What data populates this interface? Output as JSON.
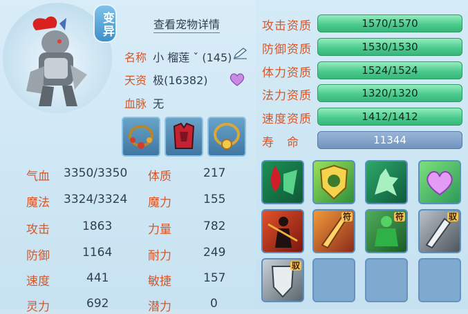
{
  "pet": {
    "mutation_badge": "变异",
    "view_details": "查看宠物详情",
    "name_label": "名称",
    "name_value": "小 榴莲 ˇ (145)",
    "talent_label": "天资",
    "talent_value": "极(16382)",
    "bloodline_label": "血脉",
    "bloodline_value": "无"
  },
  "equipment": [
    {
      "icon": "necklace-red-icon"
    },
    {
      "icon": "armor-red-icon"
    },
    {
      "icon": "necklace-gold-icon"
    }
  ],
  "stats": {
    "left": [
      {
        "label": "气血",
        "value": "3350/3350"
      },
      {
        "label": "魔法",
        "value": "3324/3324"
      },
      {
        "label": "攻击",
        "value": "1863"
      },
      {
        "label": "防御",
        "value": "1164"
      },
      {
        "label": "速度",
        "value": "441"
      },
      {
        "label": "灵力",
        "value": "692"
      }
    ],
    "right": [
      {
        "label": "体质",
        "value": "217"
      },
      {
        "label": "魔力",
        "value": "155"
      },
      {
        "label": "力量",
        "value": "782"
      },
      {
        "label": "耐力",
        "value": "249"
      },
      {
        "label": "敏捷",
        "value": "157"
      },
      {
        "label": "潜力",
        "value": "0"
      }
    ]
  },
  "qualifications": [
    {
      "label": "攻击资质",
      "value": "1570/1570"
    },
    {
      "label": "防御资质",
      "value": "1530/1530"
    },
    {
      "label": "体力资质",
      "value": "1524/1524"
    },
    {
      "label": "法力资质",
      "value": "1320/1320"
    },
    {
      "label": "速度资质",
      "value": "1412/1412"
    },
    {
      "label": "寿　命",
      "value": "11344"
    }
  ],
  "skills": [
    {
      "icon": "blood-drain-skill-icon"
    },
    {
      "icon": "shield-emblem-skill-icon"
    },
    {
      "icon": "green-beast-skill-icon"
    },
    {
      "icon": "purple-heart-skill-icon"
    },
    {
      "icon": "shadow-assassin-skill-icon"
    },
    {
      "icon": "gold-blade-skill-icon",
      "tag": "符"
    },
    {
      "icon": "green-brute-skill-icon",
      "tag": "符"
    },
    {
      "icon": "silver-blade-skill-icon",
      "tag": "驭"
    },
    {
      "icon": "silver-shield-skill-icon",
      "tag": "驭"
    }
  ],
  "colors": {
    "label": "#d4572a",
    "green_bar": "#4ccb8d",
    "blue_bar": "#6f92bd"
  }
}
